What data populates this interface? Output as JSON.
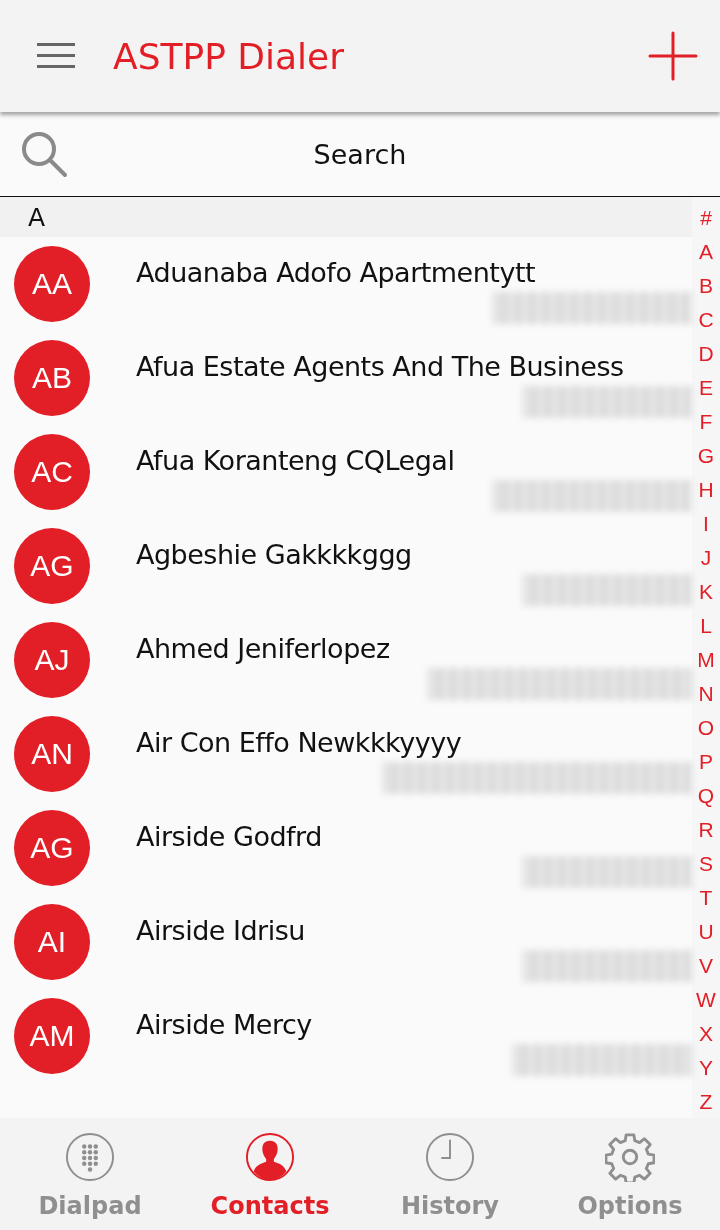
{
  "app_bar": {
    "title": "ASTPP Dialer"
  },
  "search": {
    "placeholder": "Search"
  },
  "section": {
    "letter": "A"
  },
  "contacts": [
    {
      "initials": "AA",
      "name": "Aduanaba Adofo Apartmentytt"
    },
    {
      "initials": "AB",
      "name": "Afua Estate Agents And The Business"
    },
    {
      "initials": "AC",
      "name": "Afua Koranteng CQLegal"
    },
    {
      "initials": "AG",
      "name": "Agbeshie Gakkkkggg"
    },
    {
      "initials": "AJ",
      "name": "Ahmed Jeniferlopez"
    },
    {
      "initials": "AN",
      "name": "Air Con Effo Newkkkyyyy"
    },
    {
      "initials": "AG",
      "name": "Airside Godfrd"
    },
    {
      "initials": "AI",
      "name": "Airside Idrisu"
    },
    {
      "initials": "AM",
      "name": "Airside Mercy"
    }
  ],
  "index": [
    "#",
    "A",
    "B",
    "C",
    "D",
    "E",
    "F",
    "G",
    "H",
    "I",
    "J",
    "K",
    "L",
    "M",
    "N",
    "O",
    "P",
    "Q",
    "R",
    "S",
    "T",
    "U",
    "V",
    "W",
    "X",
    "Y",
    "Z"
  ],
  "tabs": [
    {
      "kind": "dialpad",
      "label": "Dialpad",
      "selected": false
    },
    {
      "kind": "contacts",
      "label": "Contacts",
      "selected": true
    },
    {
      "kind": "history",
      "label": "History",
      "selected": false
    },
    {
      "kind": "options",
      "label": "Options",
      "selected": false
    }
  ]
}
